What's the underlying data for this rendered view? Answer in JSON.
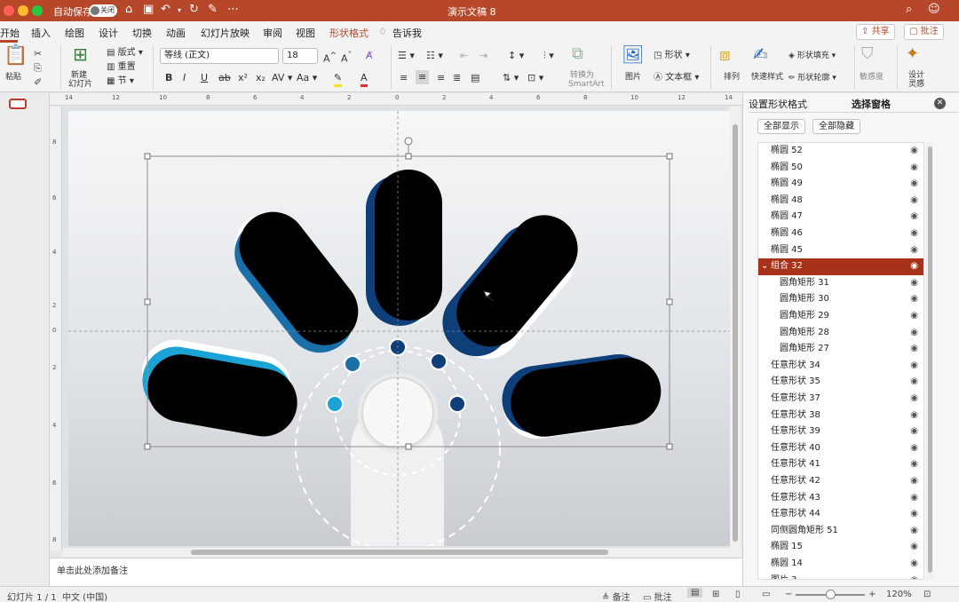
{
  "titlebar": {
    "autosave_label": "自动保存",
    "autosave_state": "关闭",
    "title": "演示文稿 8"
  },
  "tabs": [
    "开始",
    "插入",
    "绘图",
    "设计",
    "切换",
    "动画",
    "幻灯片放映",
    "审阅",
    "视图",
    "形状格式"
  ],
  "tell_me": "告诉我",
  "share_label": "共享",
  "comment_label": "批注",
  "ribbon": {
    "paste": "粘贴",
    "new_slide_line1": "新建",
    "new_slide_line2": "幻灯片",
    "layout": "版式",
    "reset": "重置",
    "section": "节",
    "font_name": "等线 (正文)",
    "font_size": "18",
    "convert_line1": "转换为",
    "convert_line2": "SmartArt",
    "picture": "图片",
    "shape": "形状",
    "textbox": "文本框",
    "arrange": "排列",
    "quick_styles": "快速样式",
    "shape_fill": "形状填充",
    "shape_outline": "形状轮廓",
    "sensitivity": "敏感度",
    "designer_line1": "设计",
    "designer_line2": "灵感"
  },
  "notes_placeholder": "单击此处添加备注",
  "status": {
    "slide": "幻灯片 1 / 1",
    "language": "中文 (中国)",
    "notes": "备注",
    "comments": "批注",
    "zoom": "120%"
  },
  "panel": {
    "tab_format": "设置形状格式",
    "tab_selection": "选择窗格",
    "show_all": "全部显示",
    "hide_all": "全部隐藏",
    "items": [
      {
        "name": "椭圆 52",
        "indent": 0
      },
      {
        "name": "椭圆 50",
        "indent": 0
      },
      {
        "name": "椭圆 49",
        "indent": 0
      },
      {
        "name": "椭圆 48",
        "indent": 0
      },
      {
        "name": "椭圆 47",
        "indent": 0
      },
      {
        "name": "椭圆 46",
        "indent": 0
      },
      {
        "name": "椭圆 45",
        "indent": 0
      },
      {
        "name": "组合 32",
        "indent": 0,
        "selected": true
      },
      {
        "name": "圆角矩形 31",
        "indent": 1
      },
      {
        "name": "圆角矩形 30",
        "indent": 1
      },
      {
        "name": "圆角矩形 29",
        "indent": 1
      },
      {
        "name": "圆角矩形 28",
        "indent": 1
      },
      {
        "name": "圆角矩形 27",
        "indent": 1
      },
      {
        "name": "任意形状 34",
        "indent": 0
      },
      {
        "name": "任意形状 35",
        "indent": 0
      },
      {
        "name": "任意形状 37",
        "indent": 0
      },
      {
        "name": "任意形状 38",
        "indent": 0
      },
      {
        "name": "任意形状 39",
        "indent": 0
      },
      {
        "name": "任意形状 40",
        "indent": 0
      },
      {
        "name": "任意形状 41",
        "indent": 0
      },
      {
        "name": "任意形状 42",
        "indent": 0
      },
      {
        "name": "任意形状 43",
        "indent": 0
      },
      {
        "name": "任意形状 44",
        "indent": 0
      },
      {
        "name": "同侧圆角矩形 51",
        "indent": 0
      },
      {
        "name": "椭圆 15",
        "indent": 0
      },
      {
        "name": "椭圆 14",
        "indent": 0
      },
      {
        "name": "图片 3",
        "indent": 0
      }
    ]
  },
  "ruler_labels": [
    "14",
    "12",
    "10",
    "8",
    "6",
    "4",
    "2",
    "0",
    "2",
    "4",
    "6",
    "8",
    "10",
    "12",
    "14"
  ],
  "vruler_labels": [
    "8",
    "6",
    "4",
    "2",
    "0",
    "2",
    "4",
    "6",
    "8"
  ],
  "colors": {
    "accent": "#b7472a",
    "selected_row": "#a83219",
    "dot_dark": "#0f3f78",
    "dot_mid": "#1b6fa8",
    "dot_light": "#1ba3d6"
  }
}
